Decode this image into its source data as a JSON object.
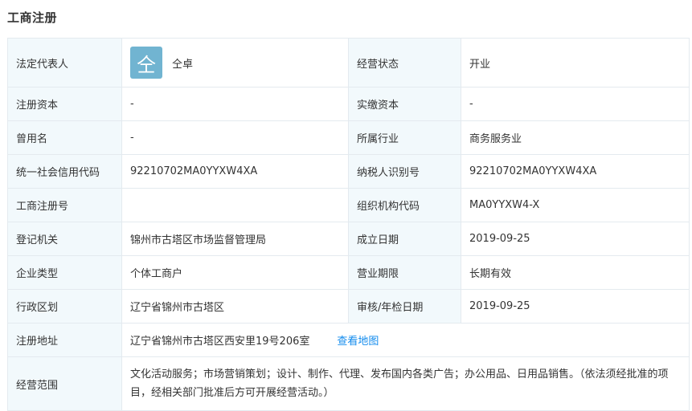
{
  "section": {
    "title": "工商注册"
  },
  "colors": {
    "avatar_bg": "#71b4d1",
    "link": "#128bed",
    "label_bg": "#f2f9fc",
    "border": "#e4eaef"
  },
  "legal_rep": {
    "label": "法定代表人",
    "avatar_char": "仝",
    "name": "仝卓"
  },
  "status": {
    "label": "经营状态",
    "value": "开业"
  },
  "reg_capital": {
    "label": "注册资本",
    "value": "-"
  },
  "paid_capital": {
    "label": "实缴资本",
    "value": "-"
  },
  "former_name": {
    "label": "曾用名",
    "value": "-"
  },
  "industry": {
    "label": "所属行业",
    "value": "商务服务业"
  },
  "credit_code": {
    "label": "统一社会信用代码",
    "value": "92210702MA0YYXW4XA"
  },
  "taxpayer_id": {
    "label": "纳税人识别号",
    "value": "92210702MA0YYXW4XA"
  },
  "reg_no": {
    "label": "工商注册号",
    "value": ""
  },
  "org_code": {
    "label": "组织机构代码",
    "value": "MA0YYXW4-X"
  },
  "authority": {
    "label": "登记机关",
    "value": "锦州市古塔区市场监督管理局"
  },
  "founded": {
    "label": "成立日期",
    "value": "2019-09-25"
  },
  "company_type": {
    "label": "企业类型",
    "value": "个体工商户"
  },
  "term": {
    "label": "营业期限",
    "value": "长期有效"
  },
  "region": {
    "label": "行政区划",
    "value": "辽宁省锦州市古塔区"
  },
  "approval_date": {
    "label": "审核/年检日期",
    "value": "2019-09-25"
  },
  "address": {
    "label": "注册地址",
    "value": "辽宁省锦州市古塔区西安里19号206室",
    "map_link": "查看地图"
  },
  "scope": {
    "label": "经营范围",
    "value": "文化活动服务；市场营销策划；设计、制作、代理、发布国内各类广告；办公用品、日用品销售。（依法须经批准的项目，经相关部门批准后方可开展经营活动。）"
  }
}
